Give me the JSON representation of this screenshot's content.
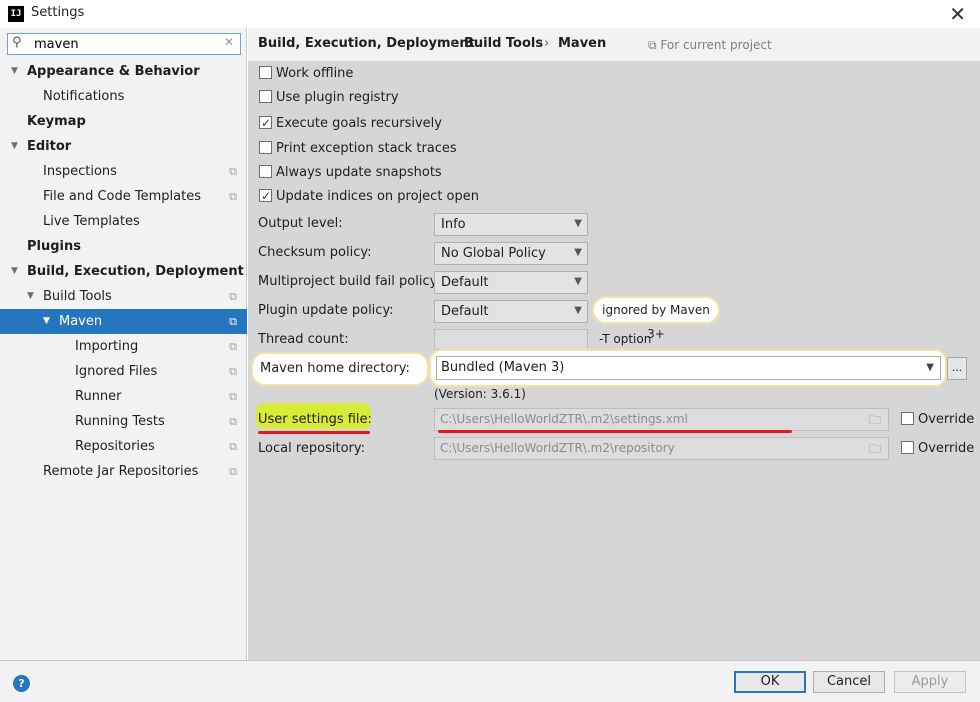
{
  "window": {
    "title": "Settings",
    "app_icon": "IJ"
  },
  "search": {
    "value": "maven",
    "placeholder": ""
  },
  "tree": [
    {
      "label": "Appearance & Behavior",
      "bold": true,
      "expanded": true,
      "level": 0,
      "copy": false
    },
    {
      "label": "Notifications",
      "bold": false,
      "level": 1,
      "copy": false
    },
    {
      "label": "Keymap",
      "bold": true,
      "level": 0,
      "copy": false
    },
    {
      "label": "Editor",
      "bold": true,
      "expanded": true,
      "level": 0,
      "copy": false
    },
    {
      "label": "Inspections",
      "bold": false,
      "level": 1,
      "copy": true
    },
    {
      "label": "File and Code Templates",
      "bold": false,
      "level": 1,
      "copy": true
    },
    {
      "label": "Live Templates",
      "bold": false,
      "level": 1,
      "copy": false
    },
    {
      "label": "Plugins",
      "bold": true,
      "level": 0,
      "copy": false
    },
    {
      "label": "Build, Execution, Deployment",
      "bold": true,
      "expanded": true,
      "level": 0,
      "copy": false
    },
    {
      "label": "Build Tools",
      "bold": false,
      "expanded": true,
      "level": 1,
      "copy": true
    },
    {
      "label": "Maven",
      "bold": false,
      "expanded": true,
      "level": 2,
      "copy": true,
      "selected": true
    },
    {
      "label": "Importing",
      "bold": false,
      "level": 3,
      "copy": true
    },
    {
      "label": "Ignored Files",
      "bold": false,
      "level": 3,
      "copy": true
    },
    {
      "label": "Runner",
      "bold": false,
      "level": 3,
      "copy": true
    },
    {
      "label": "Running Tests",
      "bold": false,
      "level": 3,
      "copy": true
    },
    {
      "label": "Repositories",
      "bold": false,
      "level": 3,
      "copy": true
    },
    {
      "label": "Remote Jar Repositories",
      "bold": false,
      "level": 1,
      "copy": true
    }
  ],
  "breadcrumb": {
    "items": [
      "Build, Execution, Deployment",
      "Build Tools",
      "Maven"
    ],
    "separator": "›",
    "scope": "For current project"
  },
  "checkboxes": [
    {
      "label": "Work offline",
      "checked": false
    },
    {
      "label": "Use plugin registry",
      "checked": false
    },
    {
      "label": "Execute goals recursively",
      "checked": true
    },
    {
      "label": "Print exception stack traces",
      "checked": false
    },
    {
      "label": "Always update snapshots",
      "checked": false
    },
    {
      "label": "Update indices on project open",
      "checked": true
    }
  ],
  "fields": {
    "output_level": {
      "label": "Output level:",
      "value": "Info"
    },
    "checksum_policy": {
      "label": "Checksum policy:",
      "value": "No Global Policy"
    },
    "multiproject_fail": {
      "label": "Multiproject build fail policy:",
      "value": "Default"
    },
    "plugin_update": {
      "label": "Plugin update policy:",
      "value": "Default",
      "note": "ignored by Maven 3+"
    },
    "thread_count": {
      "label": "Thread count:",
      "value": "",
      "note": "-T option"
    },
    "maven_home": {
      "label": "Maven home directory:",
      "value": "Bundled (Maven 3)",
      "browse": "...",
      "version": "(Version: 3.6.1)"
    },
    "user_settings": {
      "label": "User settings file:",
      "value": "C:\\Users\\HelloWorldZTR\\.m2\\settings.xml",
      "override": "Override",
      "override_checked": false
    },
    "local_repo": {
      "label": "Local repository:",
      "value": "C:\\Users\\HelloWorldZTR\\.m2\\repository",
      "override": "Override",
      "override_checked": false
    }
  },
  "buttons": {
    "ok": "OK",
    "cancel": "Cancel",
    "apply": "Apply",
    "help": "?"
  },
  "colors": {
    "selection": "#2675bf",
    "highlight": "#d8ef1a",
    "annotation_red": "#e1191f",
    "callout_border": "#efe3a8"
  }
}
